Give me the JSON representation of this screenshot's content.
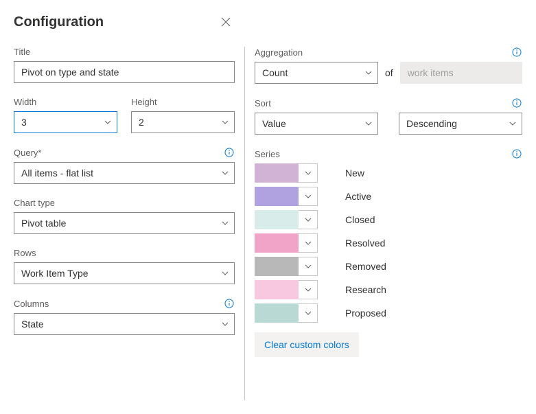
{
  "header": {
    "title": "Configuration"
  },
  "left": {
    "title_label": "Title",
    "title_value": "Pivot on type and state",
    "width_label": "Width",
    "width_value": "3",
    "height_label": "Height",
    "height_value": "2",
    "query_label": "Query*",
    "query_value": "All items - flat list",
    "charttype_label": "Chart type",
    "charttype_value": "Pivot table",
    "rows_label": "Rows",
    "rows_value": "Work Item Type",
    "columns_label": "Columns",
    "columns_value": "State"
  },
  "right": {
    "aggregation_label": "Aggregation",
    "aggregation_value": "Count",
    "aggregation_of": "of",
    "aggregation_target": "work items",
    "sort_label": "Sort",
    "sort_by": "Value",
    "sort_dir": "Descending",
    "series_label": "Series",
    "series": [
      {
        "label": "New",
        "color": "#d0b3d5"
      },
      {
        "label": "Active",
        "color": "#b0a1e0"
      },
      {
        "label": "Closed",
        "color": "#d8ecea"
      },
      {
        "label": "Resolved",
        "color": "#f2a4c8"
      },
      {
        "label": "Removed",
        "color": "#b8b8b8"
      },
      {
        "label": "Research",
        "color": "#f7c8df"
      },
      {
        "label": "Proposed",
        "color": "#b8d9d4"
      }
    ],
    "clear_label": "Clear custom colors"
  }
}
